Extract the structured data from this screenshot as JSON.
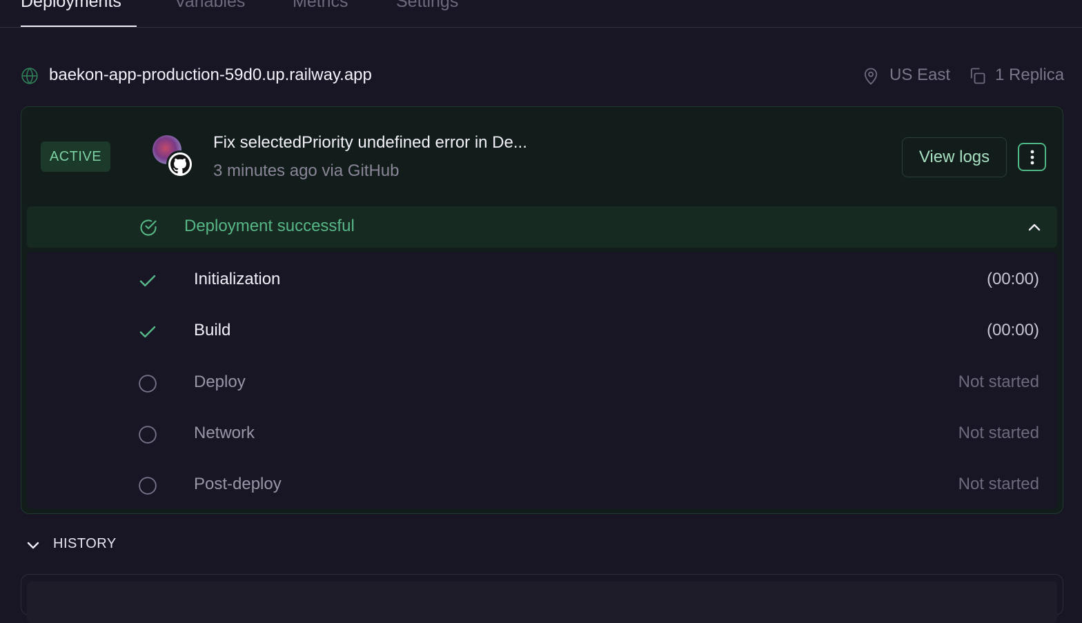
{
  "tabs": [
    {
      "label": "Deployments",
      "active": true
    },
    {
      "label": "Variables",
      "active": false
    },
    {
      "label": "Metrics",
      "active": false
    },
    {
      "label": "Settings",
      "active": false
    }
  ],
  "service": {
    "url": "baekon-app-production-59d0.up.railway.app",
    "region": "US East",
    "replicas": "1 Replica"
  },
  "deployment": {
    "status_badge": "ACTIVE",
    "commit_message": "Fix selectedPriority undefined error in De...",
    "commit_meta": "3 minutes ago via GitHub",
    "view_logs_label": "View logs",
    "result": "Deployment successful",
    "steps": [
      {
        "label": "Initialization",
        "status": "done",
        "time": "(00:00)"
      },
      {
        "label": "Build",
        "status": "done",
        "time": "(00:00)"
      },
      {
        "label": "Deploy",
        "status": "pending",
        "time": "Not started"
      },
      {
        "label": "Network",
        "status": "pending",
        "time": "Not started"
      },
      {
        "label": "Post-deploy",
        "status": "pending",
        "time": "Not started"
      }
    ]
  },
  "history": {
    "label": "HISTORY"
  },
  "icons": {
    "globe": "globe-icon",
    "region": "map-pin-icon",
    "replicas": "copy-icon",
    "github": "github-icon",
    "more": "more-vertical-icon",
    "result": "check-circle-icon",
    "collapse": "chevron-up-icon",
    "step_done": "check-icon",
    "step_pending": "circle-icon",
    "history": "chevron-down-icon"
  },
  "colors": {
    "background": "#181624",
    "card_background": "#121c1b",
    "accent_green": "#57b787",
    "badge_text": "#7fd2a4"
  }
}
